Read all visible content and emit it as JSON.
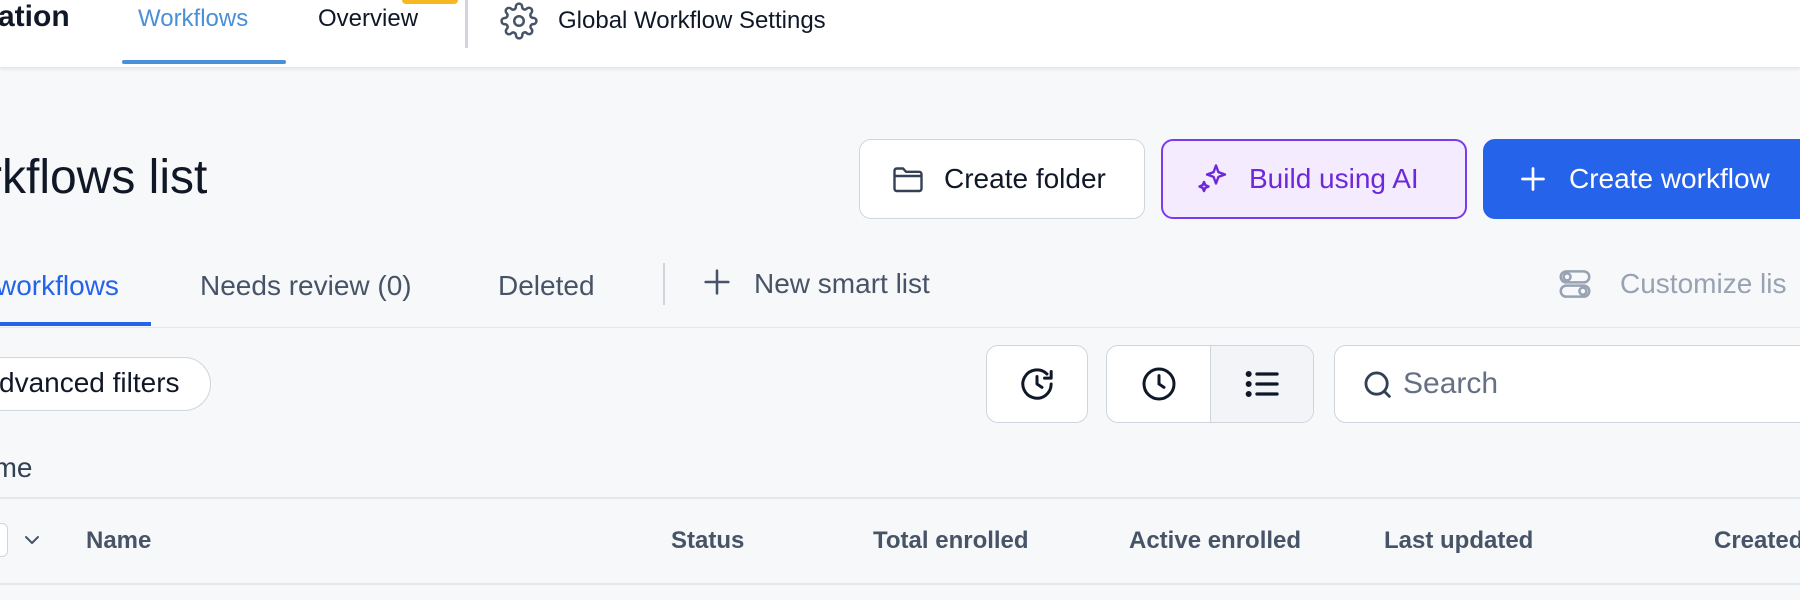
{
  "topnav": {
    "app_title": "ation",
    "tabs": [
      {
        "label": "Workflows",
        "active": true
      },
      {
        "label": "Overview",
        "active": false
      }
    ],
    "settings_label": "Global Workflow Settings"
  },
  "header": {
    "title": "rkflows list",
    "buttons": {
      "create_folder": "Create folder",
      "build_ai": "Build using AI",
      "create_workflow": "Create workflow"
    }
  },
  "subtabs": {
    "items": [
      {
        "label": "workflows",
        "active": true
      },
      {
        "label": "Needs review (0)",
        "active": false
      },
      {
        "label": "Deleted",
        "active": false
      }
    ],
    "new_smart_list": "New smart list",
    "customize": "Customize lis"
  },
  "filters": {
    "advanced": "dvanced filters",
    "search_placeholder": "Search",
    "search_value": ""
  },
  "breadcrumb": "ome",
  "table": {
    "columns": [
      "Name",
      "Status",
      "Total enrolled",
      "Active enrolled",
      "Last updated",
      "Created"
    ]
  },
  "colors": {
    "accent_blue": "#2563eb",
    "nav_active": "#4a90d9",
    "ai_purple": "#6d28d9",
    "ai_bg": "#f4ebff",
    "badge_yellow": "#f5b820"
  },
  "icons": [
    "gear-icon",
    "folder-icon",
    "sparkle-icon",
    "plus-icon",
    "customize-icon",
    "history-icon",
    "clock-icon",
    "list-icon",
    "search-icon",
    "chevron-down-icon"
  ]
}
